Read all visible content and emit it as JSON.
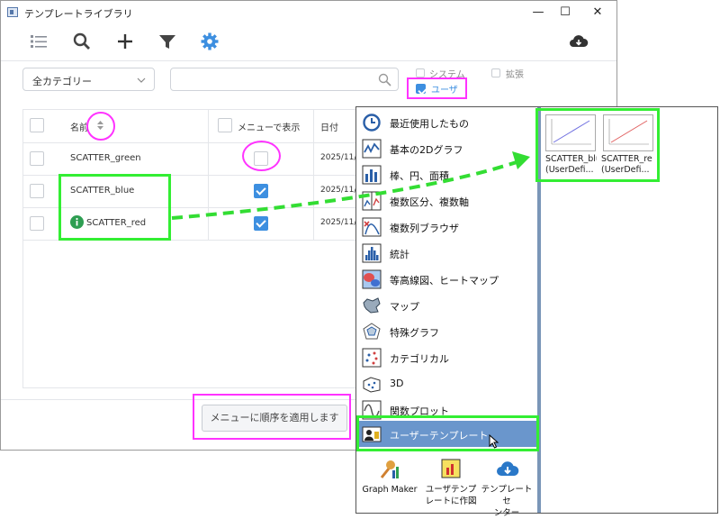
{
  "window": {
    "title": "テンプレートライブラリ",
    "controls": {
      "minimize": "—",
      "maximize": "☐",
      "close": "✕"
    }
  },
  "toolbar": {
    "icons": [
      "list-icon",
      "search-icon",
      "add-icon",
      "filter-icon",
      "gear-icon",
      "cloud-download-icon"
    ]
  },
  "filters": {
    "category_value": "全カテゴリー",
    "search_placeholder": "",
    "system_label": "システム",
    "extension_label": "拡張",
    "user_label": "ユーザ"
  },
  "table": {
    "headers": {
      "name": "名前",
      "show_in_menu": "メニューで表示",
      "date": "日付"
    },
    "rows": [
      {
        "name": "SCATTER_green",
        "show_in_menu": false,
        "date": "2025/11/..."
      },
      {
        "name": "SCATTER_blue",
        "show_in_menu": true,
        "date": "2025/11/..."
      },
      {
        "name": "SCATTER_red",
        "show_in_menu": true,
        "date": "2025/11/..."
      }
    ]
  },
  "apply_button": "メニューに順序を適用します",
  "menu": {
    "items": [
      {
        "label": "最近使用したもの",
        "icon": "clock-icon"
      },
      {
        "label": "基本の2Dグラフ",
        "icon": "line-graph-icon"
      },
      {
        "label": "棒、円、面積",
        "icon": "bar-chart-icon"
      },
      {
        "label": "複数区分、複数軸",
        "icon": "multi-panel-icon"
      },
      {
        "label": "複数列ブラウザ",
        "icon": "column-browser-icon"
      },
      {
        "label": "統計",
        "icon": "histogram-icon"
      },
      {
        "label": "等高線図、ヒートマップ",
        "icon": "contour-icon"
      },
      {
        "label": "マップ",
        "icon": "map-icon"
      },
      {
        "label": "特殊グラフ",
        "icon": "radar-icon"
      },
      {
        "label": "カテゴリカル",
        "icon": "categorical-icon"
      },
      {
        "label": "3D",
        "icon": "3d-icon"
      },
      {
        "label": "関数プロット",
        "icon": "function-plot-icon"
      },
      {
        "label": "ユーザーテンプレート",
        "icon": "user-template-icon",
        "selected": true
      }
    ],
    "bottom": [
      {
        "label": "Graph Maker",
        "icon": "graph-maker-icon"
      },
      {
        "label": "ユーザテンプ\nレートに作図",
        "icon": "user-template-plot-icon"
      },
      {
        "label": "テンプレートセ\nンター",
        "icon": "cloud-download-icon"
      }
    ],
    "templates": [
      {
        "name": "SCATTER_blu",
        "sub": "(UserDefi...",
        "line_color": "#7070e0"
      },
      {
        "name": "SCATTER_re",
        "sub": "(UserDefi...",
        "line_color": "#e06060"
      }
    ]
  },
  "colors": {
    "accent_blue": "#3d8fe0",
    "highlight_magenta": "#ff33ff",
    "highlight_green": "#33ee33",
    "menu_selected": "#6a96cc"
  }
}
